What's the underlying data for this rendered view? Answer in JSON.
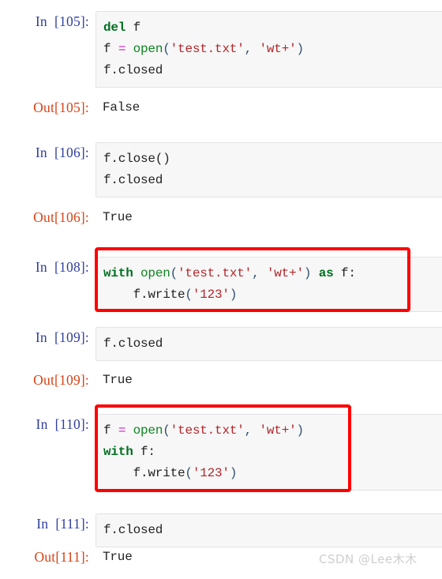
{
  "colors": {
    "in_prompt": "#303F9F",
    "out_prompt": "#D84315",
    "cell_bg": "#f7f7f7",
    "cell_border": "#e3e3e3",
    "annotation_box": "#ff0000",
    "keyword": "#007020",
    "function": "#0e8420",
    "string": "#b4252a",
    "operator": "#cc22cc",
    "text": "#222222",
    "watermark": "#cfcfcf"
  },
  "cells": [
    {
      "prompt": "In  [105]:",
      "kind": "input",
      "lines": [
        "del f",
        "f = open('test.txt', 'wt+')",
        "f.closed"
      ]
    },
    {
      "prompt": "Out[105]:",
      "kind": "output",
      "lines": [
        "False"
      ]
    },
    {
      "prompt": "In  [106]:",
      "kind": "input",
      "lines": [
        "f.close()",
        "f.closed"
      ]
    },
    {
      "prompt": "Out[106]:",
      "kind": "output",
      "lines": [
        "True"
      ]
    },
    {
      "prompt": "In  [108]:",
      "kind": "input",
      "highlighted": true,
      "lines": [
        "with open('test.txt', 'wt+') as f:",
        "    f.write('123')"
      ]
    },
    {
      "prompt": "In  [109]:",
      "kind": "input",
      "lines": [
        "f.closed"
      ]
    },
    {
      "prompt": "Out[109]:",
      "kind": "output",
      "lines": [
        "True"
      ]
    },
    {
      "prompt": "In  [110]:",
      "kind": "input",
      "highlighted": true,
      "lines": [
        "f = open('test.txt', 'wt+')",
        "with f:",
        "    f.write('123')"
      ]
    },
    {
      "prompt": "In  [111]:",
      "kind": "input",
      "lines": [
        "f.closed"
      ]
    },
    {
      "prompt": "Out[111]:",
      "kind": "output",
      "lines": [
        "True"
      ]
    }
  ],
  "prompts": {
    "in_105": "In  [105]:",
    "out_105": "Out[105]:",
    "in_106": "In  [106]:",
    "out_106": "Out[106]:",
    "in_108": "In  [108]:",
    "in_109": "In  [109]:",
    "out_109": "Out[109]:",
    "in_110": "In  [110]:",
    "in_111": "In  [111]:",
    "out_111": "Out[111]:"
  },
  "outputs": {
    "out_105": "False",
    "out_106": "True",
    "out_109": "True",
    "out_111": "True"
  },
  "code": {
    "c105": {
      "l1_kw": "del",
      "l1_rest": " f",
      "l2_var": "f ",
      "l2_eq": "=",
      "l2_fn": " open",
      "l2_open": "(",
      "l2_s1": "'test.txt'",
      "l2_comma": ", ",
      "l2_s2": "'wt+'",
      "l2_close": ")",
      "l3": "f.closed"
    },
    "c106": {
      "l1": "f.close()",
      "l2": "f.closed"
    },
    "c108": {
      "l1_kw": "with",
      "l1_fn": " open",
      "l1_open": "(",
      "l1_s1": "'test.txt'",
      "l1_comma": ", ",
      "l1_s2": "'wt+'",
      "l1_close": ")",
      "l1_as": " as",
      "l1_tail": " f:",
      "l2_pre": "    f.write",
      "l2_open": "(",
      "l2_s": "'123'",
      "l2_close": ")"
    },
    "c109": {
      "l1": "f.closed"
    },
    "c110": {
      "l1_var": "f ",
      "l1_eq": "=",
      "l1_fn": " open",
      "l1_open": "(",
      "l1_s1": "'test.txt'",
      "l1_comma": ", ",
      "l1_s2": "'wt+'",
      "l1_close": ")",
      "l2_kw": "with",
      "l2_tail": " f:",
      "l3_pre": "    f.write",
      "l3_open": "(",
      "l3_s": "'123'",
      "l3_close": ")"
    },
    "c111": {
      "l1": "f.closed"
    }
  },
  "watermark": {
    "text": "CSDN @Lee木木"
  }
}
